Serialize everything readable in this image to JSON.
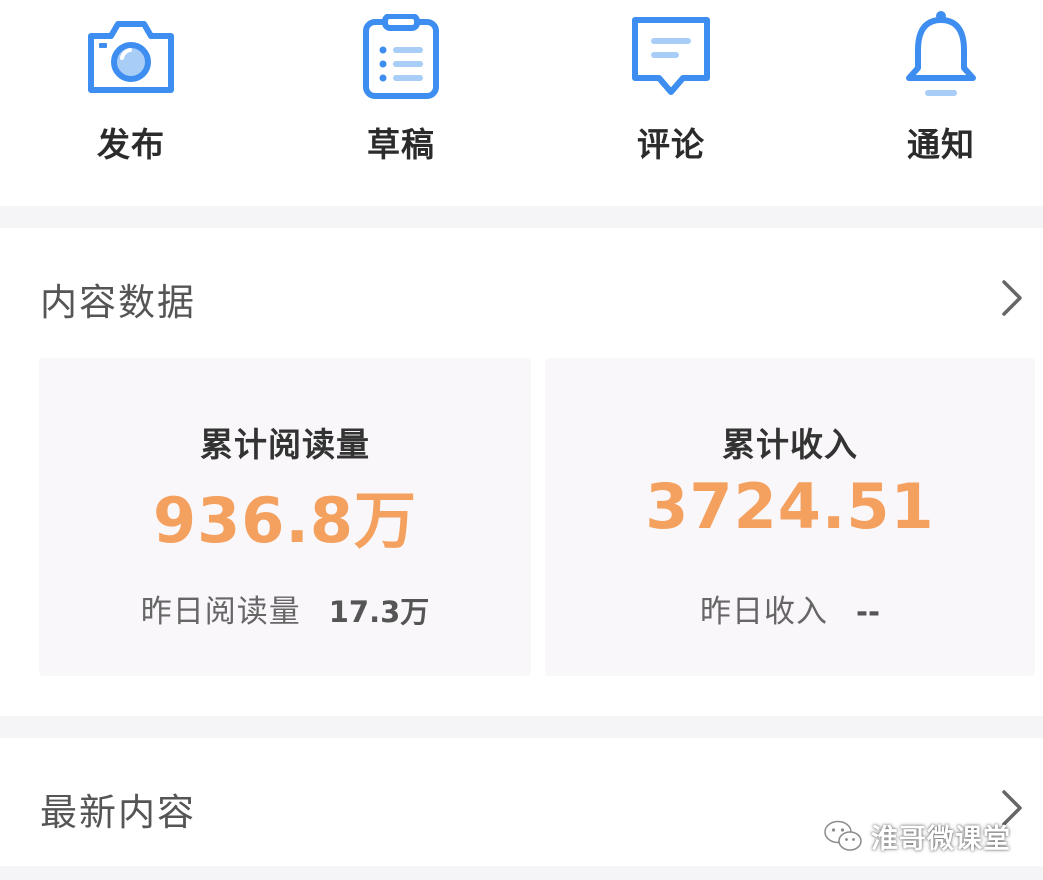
{
  "quick_actions": [
    {
      "label": "发布",
      "icon": "camera-icon"
    },
    {
      "label": "草稿",
      "icon": "clipboard-list-icon"
    },
    {
      "label": "评论",
      "icon": "comment-icon"
    },
    {
      "label": "通知",
      "icon": "bell-icon"
    }
  ],
  "content_data": {
    "title": "内容数据",
    "cards": [
      {
        "title": "累计阅读量",
        "value": "936.8万",
        "sub_label": "昨日阅读量",
        "sub_value": "17.3万"
      },
      {
        "title": "累计收入",
        "value": "3724.51",
        "sub_label": "昨日收入",
        "sub_value": "--"
      }
    ]
  },
  "latest_content": {
    "title": "最新内容"
  },
  "watermark": {
    "text": "淮哥微课堂",
    "icon": "wechat-icon"
  },
  "colors": {
    "icon_blue": "#3d8ef0",
    "icon_light_blue": "#a8cdf7",
    "accent_orange": "#f4a05e",
    "card_background": "#faf7fa",
    "separator": "#f5f5f7"
  }
}
